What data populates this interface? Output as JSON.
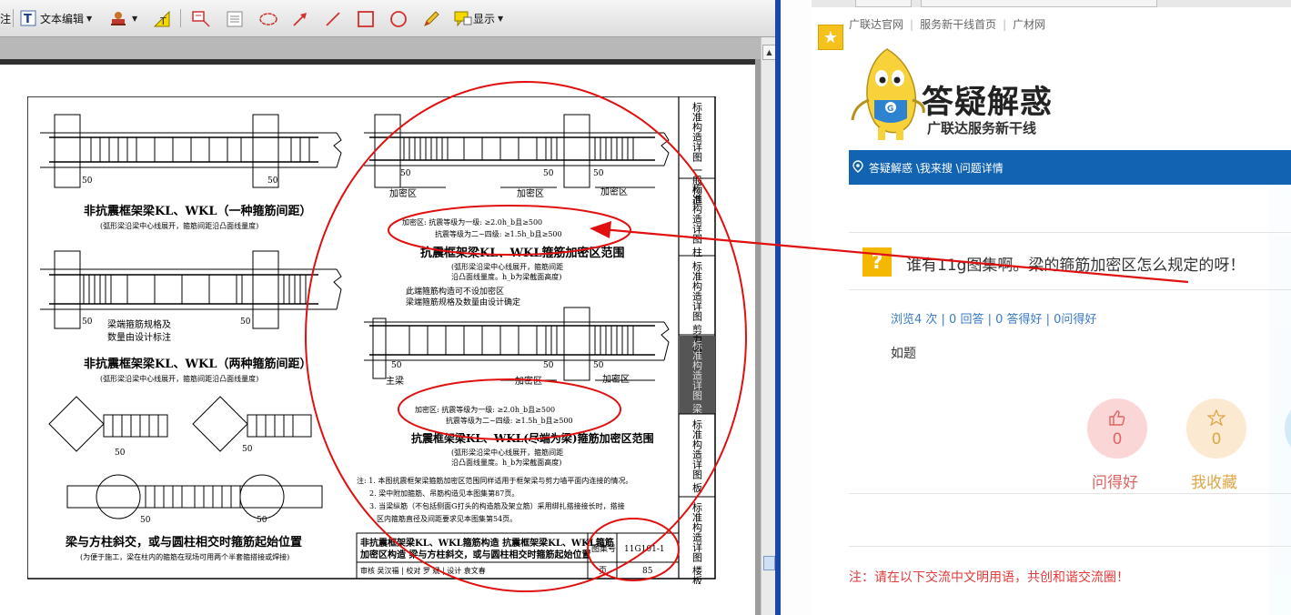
{
  "toolbar": {
    "left_fragment": "注",
    "text_edit_label": "文本编辑",
    "display_label": "显示"
  },
  "drawing": {
    "title1": "非抗震框架梁KL、WKL（一种箍筋间距）",
    "note1": "(弧形梁沿梁中心线展开，箍筋间距沿凸面线量度)",
    "title2": "非抗震框架梁KL、WKL（两种箍筋间距）",
    "note2": "(弧形梁沿梁中心线展开，箍筋间距沿凸面线量度)",
    "label_stirrup": "梁端箍筋规格及",
    "label_stirrup2": "数量由设计标注",
    "title3": "梁与方柱斜交，或与圆柱相交时箍筋起始位置",
    "note3": "(为便于施工，梁在柱内的箍筋在现场可用两个半套箍搭接或焊接)",
    "dense1": "加密区",
    "dense2": "加密区",
    "dense3": "加密区",
    "rule1a": "加密区: 抗震等级为一级: ≥2.0h_b且≥500",
    "rule1b": "抗震等级为二~四级: ≥1.5h_b且≥500",
    "title4": "抗震框架梁KL、WKL箍筋加密区范围",
    "note4a": "(弧形梁沿梁中心线展开，箍筋间距",
    "note4b": "沿凸面线量度。h_b为梁截面高度)",
    "mid_note1": "此端箍筋构造可不设加密区",
    "mid_note2": "梁端箍筋规格及数量由设计确定",
    "main_beam": "主梁",
    "dense4": "加密区",
    "dense5": "加密区",
    "rule2a": "加密区: 抗震等级为一级: ≥2.0h_b且≥500",
    "rule2b": "抗震等级为二~四级: ≥1.5h_b且≥500",
    "title5": "抗震框架梁KL、WKL(尽端为梁)箍筋加密区范围",
    "note5a": "(弧形梁沿梁中心线展开，箍筋间距",
    "note5b": "沿凸面线量度。h_b为梁截面高度)",
    "notes_1": "注: 1. 本图抗震框架梁箍筋加密区范围同样适用于框架梁与剪力墙平面内连接的情况。",
    "notes_2": "2. 梁中附加箍筋、吊筋构造见本图集第87页。",
    "notes_3": "3. 当梁纵筋（不包括侧面G打头的构造筋及架立筋）采用绑扎搭接接长时，搭接",
    "notes_4": "区内箍筋直径及间距要求见本图集第54页。",
    "title_block1": "非抗震框架梁KL、WKL箍筋构造  抗震框架梁KL、WKL箍筋",
    "title_block2": "加密区构造  梁与方柱斜交，或与圆柱相交时箍筋起始位置",
    "atlas_label": "图集号",
    "atlas_no": "11G101-1",
    "page_label": "页",
    "page_no": "85",
    "signoff": "审核 吴汉福 | 校对 罗 斌 | 设计 袁文春",
    "dim50": "50",
    "side_tabs": [
      "标准构造详图 一般构造",
      "标准构造详图 柱",
      "标准构造详图 剪力墙",
      "标准构造详图 梁",
      "标准构造详图 板",
      "标准构造详图 楼板相关构造"
    ]
  },
  "site": {
    "nav": [
      "广联达官网",
      "服务新干线首页",
      "广材网"
    ],
    "brand_title": "答疑解惑",
    "brand_sub": "广联达服务新干线",
    "mascot_letter": "G",
    "breadcrumb": "答疑解惑 \\我来搜 \\问题详情",
    "question_icon": "?",
    "question_title": "谁有11g图集啊。梁的箍筋加密区怎么规定的呀！",
    "stats": "浏览4 次 | 0 回答 | 0 答得好 | 0问得好",
    "body": "如题",
    "like_count": "0",
    "like_label": "问得好",
    "fav_count": "0",
    "fav_label": "我收藏",
    "notice": "注：请在以下交流中文明用语，共创和谐交流圈！"
  },
  "colors": {
    "brand_blue": "#1363b3",
    "annotation_red": "#e01010",
    "notice_red": "#e23a3a",
    "like_pink": "#e06363",
    "fav_gold": "#e0a646",
    "question_yellow": "#f5b800"
  }
}
